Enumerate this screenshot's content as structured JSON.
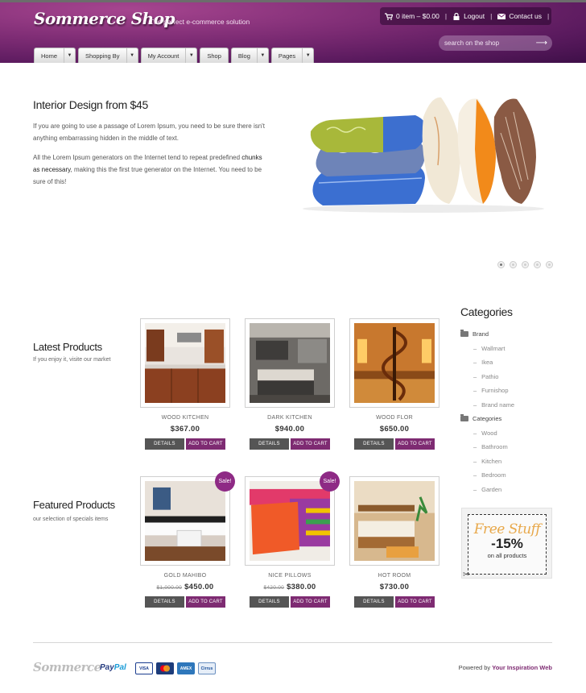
{
  "header": {
    "logo": "Sommerce Shop",
    "tagline": "The perfect e-commerce solution"
  },
  "topbar": {
    "cart": "0 item – $0.00",
    "logout": "Logout",
    "contact": "Contact us"
  },
  "search": {
    "placeholder": "search on the shop"
  },
  "nav": [
    "Home",
    "Shopping By",
    "My Account",
    "Shop",
    "Blog",
    "Pages"
  ],
  "hero": {
    "title": "Interior Design from $45",
    "p1": "If you are going to use a passage of Lorem Ipsum, you need to be sure there isn't anything embarrassing hidden in the middle of text.",
    "p2_a": "All the Lorem Ipsum generators on the Internet tend to repeat predefined ",
    "p2_b": "chunks as necessary",
    "p2_c": ", making this the first true generator on the Internet. You need to be sure of this!"
  },
  "latest": {
    "title": "Latest Products",
    "subtitle": "If you enjoy it, visite our market",
    "products": [
      {
        "name": "WOOD KITCHEN",
        "price": "$367.00",
        "icon": "kitchen-photo"
      },
      {
        "name": "DARK KITCHEN",
        "price": "$940.00",
        "icon": "dark-kitchen-photo"
      },
      {
        "name": "WOOD FLOR",
        "price": "$650.00",
        "icon": "spiral-stair-photo"
      }
    ]
  },
  "featured": {
    "title": "Featured Products",
    "subtitle": "our selection of specials items",
    "products": [
      {
        "name": "GOLD MAHIBO",
        "old": "$1,000.00",
        "price": "$450.00",
        "badge": "Sale!"
      },
      {
        "name": "NICE PILLOWS",
        "old": "$420.00",
        "price": "$380.00",
        "badge": "Sale!"
      },
      {
        "name": "HOT ROOM",
        "price": "$730.00"
      }
    ]
  },
  "buttons": {
    "details": "DETAILS",
    "add": "ADD TO CART"
  },
  "categories": {
    "title": "Categories",
    "groups": [
      {
        "label": "Brand",
        "items": [
          "Wallmart",
          "Ikea",
          "Pathio",
          "Furnishop",
          "Brand name"
        ]
      },
      {
        "label": "Categories",
        "items": [
          "Wood",
          "Bathroom",
          "Kitchen",
          "Bedroom",
          "Garden"
        ]
      }
    ]
  },
  "promo": {
    "free": "Free Stuff",
    "pct": "-15%",
    "text": "on all products"
  },
  "footer": {
    "logo": "Sommerce",
    "paypal_a": "Pay",
    "paypal_b": "Pal",
    "cards": [
      "VISA",
      "MC",
      "AMEX",
      "Cirrus"
    ],
    "powered": "Powered by ",
    "powered_link": "Your Inspiration Web"
  },
  "colors": {
    "accent": "#7e2b72",
    "header": "#6a2466"
  }
}
